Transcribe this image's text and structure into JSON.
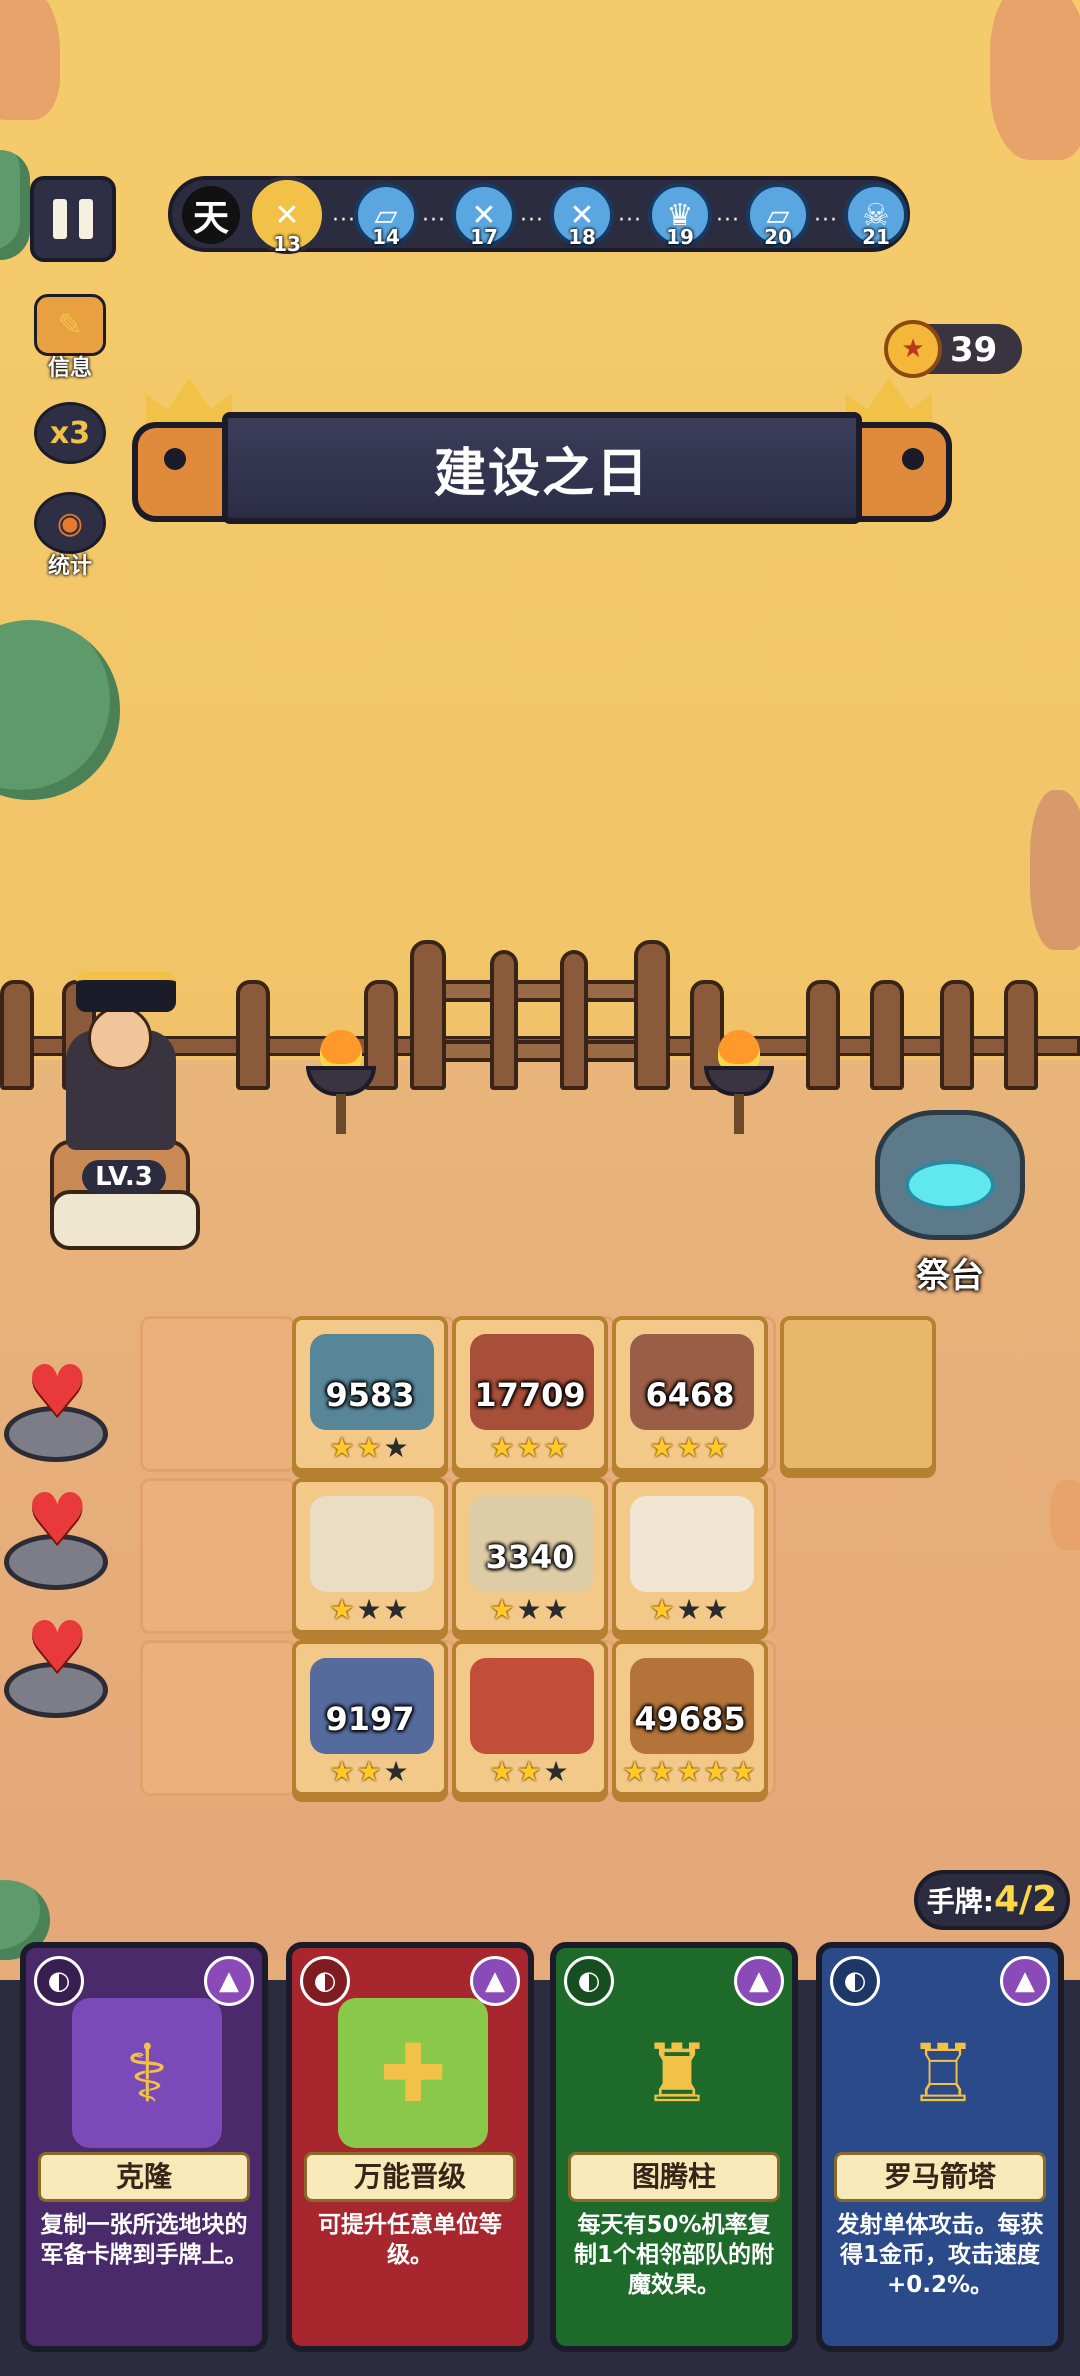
{
  "top": {
    "day_label": "天",
    "days": [
      {
        "num": "13",
        "icon": "crossed-swords-icon",
        "current": true
      },
      {
        "num": "14",
        "icon": "scroll-icon",
        "current": false
      },
      {
        "num": "17",
        "icon": "crossed-swords-icon",
        "current": false
      },
      {
        "num": "18",
        "icon": "crossed-swords-icon",
        "current": false
      },
      {
        "num": "19",
        "icon": "crown-icon",
        "current": false
      },
      {
        "num": "20",
        "icon": "scroll-icon",
        "current": false
      },
      {
        "num": "21",
        "icon": "skull-icon",
        "current": false
      }
    ],
    "dots": "···"
  },
  "side": {
    "info_label": "信息",
    "speed_label": "x3",
    "stats_label": "统计"
  },
  "coins": {
    "value": "39"
  },
  "banner": {
    "title": "建设之日"
  },
  "hero": {
    "level": "LV.3"
  },
  "altar": {
    "label": "祭台"
  },
  "lives": {
    "hearts": 3
  },
  "board": {
    "units": [
      {
        "name": "blue-archers",
        "count": "9583",
        "stars": 2,
        "color": "#3a7a9a"
      },
      {
        "name": "red-warriors",
        "count": "17709",
        "stars": 3,
        "color": "#9a3a2a"
      },
      {
        "name": "spearmen",
        "count": "6468",
        "stars": 3,
        "color": "#8a4a3a"
      },
      {
        "name": "skeleton-shrine",
        "count": "",
        "stars": 1,
        "color": "#e8e0cc"
      },
      {
        "name": "mummies",
        "count": "3340",
        "stars": 1,
        "color": "#d8ccaa"
      },
      {
        "name": "colosseum",
        "count": "",
        "stars": 1,
        "color": "#f0ebe0"
      },
      {
        "name": "blue-soldiers",
        "count": "9197",
        "stars": 2,
        "color": "#3a5aa0"
      },
      {
        "name": "war-drum",
        "count": "",
        "stars": 2,
        "color": "#b8382a"
      },
      {
        "name": "spiked-barricade",
        "count": "49685",
        "stars": 5,
        "color": "#a8642a"
      }
    ]
  },
  "hand": {
    "label": "手牌:",
    "count": "4/2"
  },
  "cards": [
    {
      "name": "克隆",
      "desc": "复制一张所选地块的军备卡牌到手牌上。",
      "bg": "#4a2a6a",
      "art_bg": "#7a4ab8",
      "glyph": "⚕"
    },
    {
      "name": "万能晋级",
      "desc": "可提升任意单位等级。",
      "bg": "#a8262e",
      "art_bg": "#8ac84a",
      "glyph": "✚"
    },
    {
      "name": "图腾柱",
      "desc": "每天有50%机率复制1个相邻部队的附魔效果。",
      "bg": "#1e6a2a",
      "art_bg": "#1e6a2a",
      "glyph": "♜"
    },
    {
      "name": "罗马箭塔",
      "desc": "发射单体攻击。每获得1金币，攻击速度+0.2%。",
      "bg": "#2a4a8a",
      "art_bg": "#2a4a8a",
      "glyph": "♖"
    }
  ]
}
